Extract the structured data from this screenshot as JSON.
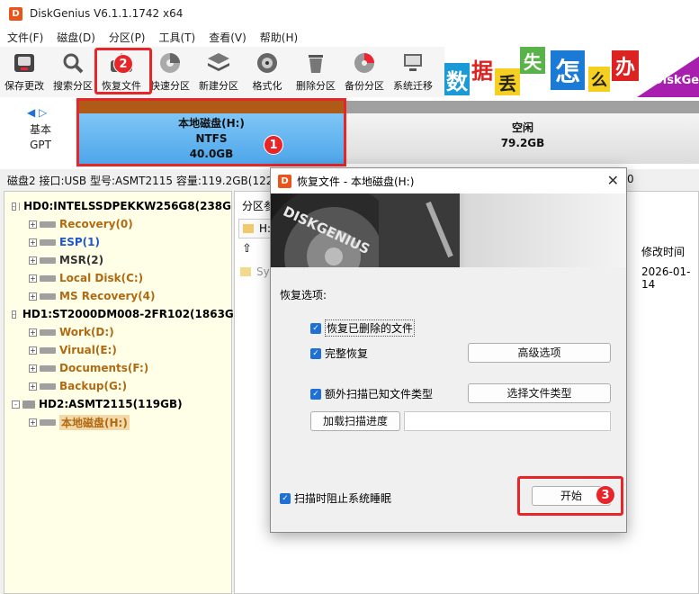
{
  "window": {
    "title": "DiskGenius V6.1.1.1742 x64",
    "app_icon": "D"
  },
  "menu": [
    "文件(F)",
    "磁盘(D)",
    "分区(P)",
    "工具(T)",
    "查看(V)",
    "帮助(H)"
  ],
  "toolbar": [
    {
      "label": "保存更改",
      "icon": "save-disk-icon"
    },
    {
      "label": "搜索分区",
      "icon": "magnifier-icon"
    },
    {
      "label": "恢复文件",
      "icon": "recover-file-icon"
    },
    {
      "label": "快速分区",
      "icon": "quick-partition-icon"
    },
    {
      "label": "新建分区",
      "icon": "layers-icon"
    },
    {
      "label": "格式化",
      "icon": "format-disk-icon"
    },
    {
      "label": "删除分区",
      "icon": "trash-icon"
    },
    {
      "label": "备份分区",
      "icon": "backup-disk-icon"
    },
    {
      "label": "系统迁移",
      "icon": "migrate-icon"
    }
  ],
  "banner": {
    "tiles": [
      "数",
      "据",
      "丢",
      "失",
      "怎",
      "么",
      "办"
    ],
    "brand": "DiskGe"
  },
  "diskmap": {
    "style_line1": "基本",
    "style_line2": "GPT",
    "partition_h": {
      "name": "本地磁盘(H:)",
      "fs": "NTFS",
      "size": "40.0GB"
    },
    "free": {
      "name": "空闲",
      "size": "79.2GB"
    }
  },
  "infobar": "磁盘2 接口:USB  型号:ASMT2115  容量:119.2GB(122",
  "infobar_tail": "0",
  "tree": [
    {
      "label": "HD0:INTELSSDPEKKW256G8(238G",
      "level": 0,
      "type": "disk",
      "expand": "-"
    },
    {
      "label": "Recovery(0)",
      "level": 1,
      "color": "orange",
      "expand": "+"
    },
    {
      "label": "ESP(1)",
      "level": 1,
      "color": "blue",
      "expand": "+"
    },
    {
      "label": "MSR(2)",
      "level": 1,
      "color": "gray",
      "expand": "+"
    },
    {
      "label": "Local Disk(C:)",
      "level": 1,
      "color": "orange",
      "expand": "+"
    },
    {
      "label": "MS Recovery(4)",
      "level": 1,
      "color": "orange",
      "expand": "+"
    },
    {
      "label": "HD1:ST2000DM008-2FR102(1863G",
      "level": 0,
      "type": "disk",
      "expand": "-"
    },
    {
      "label": "Work(D:)",
      "level": 1,
      "color": "orange",
      "expand": "+"
    },
    {
      "label": "Virual(E:)",
      "level": 1,
      "color": "orange",
      "expand": "+"
    },
    {
      "label": "Documents(F:)",
      "level": 1,
      "color": "orange",
      "expand": "+"
    },
    {
      "label": "Backup(G:)",
      "level": 1,
      "color": "orange",
      "expand": "+"
    },
    {
      "label": "HD2:ASMT2115(119GB)",
      "level": 0,
      "type": "disk",
      "expand": "-"
    },
    {
      "label": "本地磁盘(H:)",
      "level": 1,
      "color": "sel",
      "expand": "+"
    }
  ],
  "right_pane": {
    "tab": "分区参",
    "path_prefix": "H:",
    "col_modified": "修改时间",
    "row_name": "Sys",
    "row_date": "2026-01-14"
  },
  "dialog": {
    "title": "恢复文件 - 本地磁盘(H:)",
    "section": "恢复选项:",
    "opt_deleted": "恢复已删除的文件",
    "opt_full": "完整恢复",
    "btn_advanced": "高级选项",
    "opt_extra_scan": "额外扫描已知文件类型",
    "btn_select_types": "选择文件类型",
    "btn_load_progress": "加载扫描进度",
    "progress_path": "",
    "opt_prevent_sleep": "扫描时阻止系统睡眠",
    "btn_start": "开始",
    "close": "✕"
  },
  "badges": [
    "1",
    "2",
    "3"
  ]
}
